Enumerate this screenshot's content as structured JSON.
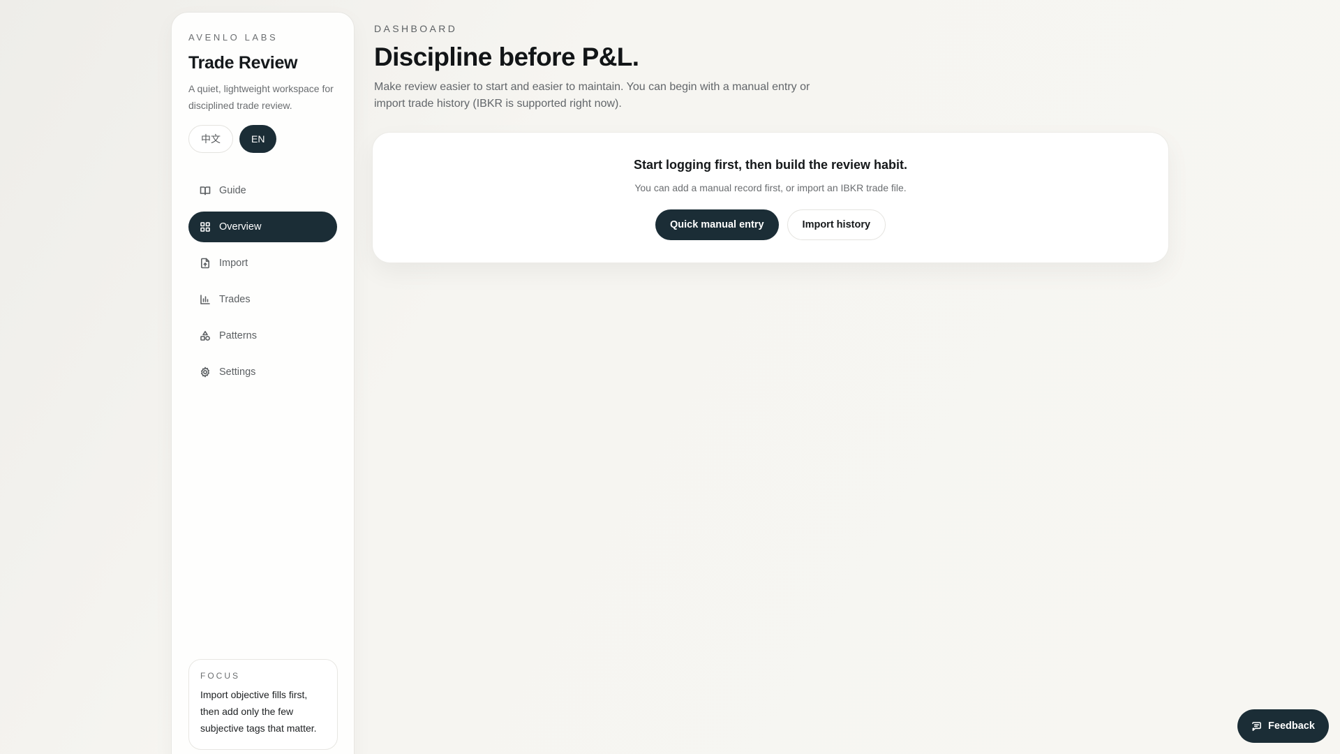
{
  "sidebar": {
    "brand_kicker": "AVENLO LABS",
    "brand_title": "Trade Review",
    "brand_desc": "A quiet, lightweight workspace for disciplined trade review.",
    "languages": [
      {
        "label": "中文",
        "active": false
      },
      {
        "label": "EN",
        "active": true
      }
    ],
    "nav": [
      {
        "label": "Guide",
        "icon": "book-icon",
        "active": false
      },
      {
        "label": "Overview",
        "icon": "grid-icon",
        "active": true
      },
      {
        "label": "Import",
        "icon": "file-import-icon",
        "active": false
      },
      {
        "label": "Trades",
        "icon": "bar-chart-icon",
        "active": false
      },
      {
        "label": "Patterns",
        "icon": "shapes-icon",
        "active": false
      },
      {
        "label": "Settings",
        "icon": "gear-icon",
        "active": false
      }
    ],
    "focus": {
      "label": "FOCUS",
      "text": "Import objective fills first, then add only the few subjective tags that matter."
    }
  },
  "main": {
    "kicker": "DASHBOARD",
    "title": "Discipline before P&L.",
    "description": "Make review easier to start and easier to maintain. You can begin with a manual entry or import trade history (IBKR is supported right now).",
    "hero": {
      "title": "Start logging first, then build the review habit.",
      "subtitle": "You can add a manual record first, or import an IBKR trade file.",
      "primary_label": "Quick manual entry",
      "secondary_label": "Import history"
    }
  },
  "feedback": {
    "label": "Feedback",
    "icon": "message-icon"
  },
  "colors": {
    "accent": "#1b2d36",
    "background": "#f4f3ef",
    "surface": "#ffffff"
  }
}
